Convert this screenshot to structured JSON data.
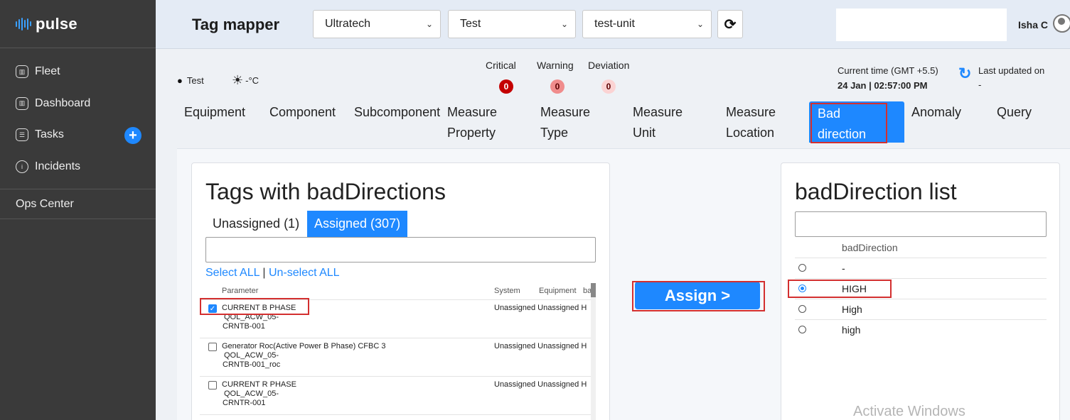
{
  "sidebar": {
    "logo": "pulse",
    "items": [
      {
        "label": "Fleet",
        "icon": "fleet-icon"
      },
      {
        "label": "Dashboard",
        "icon": "dashboard-icon"
      },
      {
        "label": "Tasks",
        "icon": "tasks-icon"
      },
      {
        "label": "Incidents",
        "icon": "info-icon"
      }
    ],
    "ops_center": "Ops Center"
  },
  "header": {
    "title": "Tag mapper",
    "selects": [
      {
        "value": "Ultratech"
      },
      {
        "value": "Test"
      },
      {
        "value": "test-unit"
      }
    ],
    "user": "Isha C"
  },
  "info": {
    "location": "Test",
    "temperature": "-°C",
    "alerts": [
      {
        "label": "Critical",
        "count": "0",
        "color": "#c40000"
      },
      {
        "label": "Warning",
        "count": "0",
        "color": "#f08c8c"
      },
      {
        "label": "Deviation",
        "count": "0",
        "color": "#fbd3d3"
      }
    ],
    "current_time_label": "Current time (GMT +5.5)",
    "current_time_value": "24 Jan | 02:57:00 PM",
    "last_updated_label": "Last updated on",
    "last_updated_value": "-"
  },
  "tabs": [
    {
      "line1": "Equipment",
      "line2": ""
    },
    {
      "line1": "Component",
      "line2": ""
    },
    {
      "line1": "Subcomponent",
      "line2": ""
    },
    {
      "line1": "Measure",
      "line2": "Property"
    },
    {
      "line1": "Measure",
      "line2": "Type"
    },
    {
      "line1": "Measure",
      "line2": "Unit"
    },
    {
      "line1": "Measure",
      "line2": "Location"
    },
    {
      "line1": "Bad",
      "line2": "direction"
    },
    {
      "line1": "Anomaly",
      "line2": ""
    },
    {
      "line1": "Query",
      "line2": ""
    }
  ],
  "tags_panel": {
    "title": "Tags with badDirections",
    "unassigned_tab": "Unassigned (1)",
    "assigned_tab": "Assigned (307)",
    "select_all": "Select ALL",
    "separator": "|",
    "unselect_all": "Un-select ALL",
    "columns": [
      "Parameter",
      "System",
      "Equipment",
      "ba"
    ],
    "rows": [
      {
        "name": "CURRENT B PHASE",
        "line2": "QOL_ACW_05-",
        "line3": "CRNTB-001",
        "system": "Unassigned",
        "equipment": "Unassigned",
        "bad": "H",
        "checked": true
      },
      {
        "name": "Generator Roc(Active Power B Phase) CFBC 3",
        "line2": "QOL_ACW_05-",
        "line3": "CRNTB-001_roc",
        "system": "Unassigned",
        "equipment": "Unassigned",
        "bad": "H",
        "checked": false
      },
      {
        "name": "CURRENT R PHASE",
        "line2": "QOL_ACW_05-",
        "line3": "CRNTR-001",
        "system": "Unassigned",
        "equipment": "Unassigned",
        "bad": "H",
        "checked": false
      }
    ]
  },
  "assign_button": "Assign >",
  "bad_direction_panel": {
    "title": "badDirection list",
    "column": "badDirection",
    "options": [
      {
        "label": "-",
        "selected": false
      },
      {
        "label": "HIGH",
        "selected": true
      },
      {
        "label": "High",
        "selected": false
      },
      {
        "label": "high",
        "selected": false
      }
    ]
  },
  "watermark": "Activate Windows"
}
